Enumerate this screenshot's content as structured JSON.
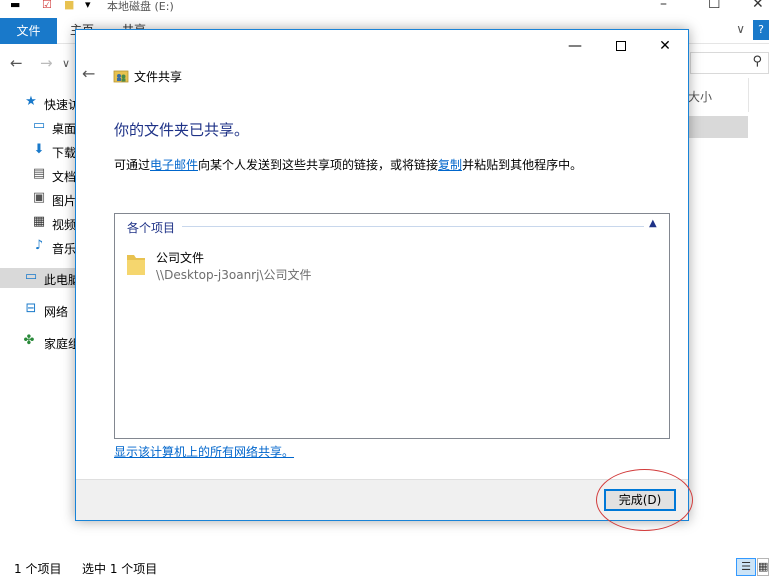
{
  "explorer": {
    "title": "本地磁盘 (E:)",
    "ribbon": {
      "file_tab": "文件",
      "tabs": [
        "主页",
        "共享"
      ]
    },
    "sidebar": [
      {
        "label": "快速访问",
        "icon": "star-icon"
      },
      {
        "label": "桌面",
        "icon": "desktop-icon"
      },
      {
        "label": "下载",
        "icon": "download-icon"
      },
      {
        "label": "文档",
        "icon": "document-icon"
      },
      {
        "label": "图片",
        "icon": "picture-icon"
      },
      {
        "label": "视频",
        "icon": "video-icon"
      },
      {
        "label": "音乐",
        "icon": "music-icon"
      },
      {
        "label": "此电脑",
        "icon": "computer-icon"
      },
      {
        "label": "网络",
        "icon": "network-icon"
      },
      {
        "label": "家庭组",
        "icon": "homegroup-icon"
      }
    ],
    "column_header": "大小",
    "status": {
      "item_count": "1 个项目",
      "selected": "选中 1 个项目"
    }
  },
  "dialog": {
    "title": "文件共享",
    "heading": "你的文件夹已共享。",
    "info": {
      "prefix": "可通过",
      "email_link": "电子邮件",
      "middle": "向某个人发送到这些共享项的链接，或将链接",
      "copy_link": "复制",
      "suffix": "并粘贴到其他程序中。"
    },
    "group_header": "各个项目",
    "items": [
      {
        "name": "公司文件",
        "path": "\\\\Desktop-j3oanrj\\公司文件"
      }
    ],
    "show_all_link": "显示该计算机上的所有网络共享。",
    "done_button": "完成(D)"
  },
  "colors": {
    "accent": "#0078d7",
    "heading": "#1e3287",
    "link": "#0066cc",
    "annotation": "#d23c3c"
  }
}
